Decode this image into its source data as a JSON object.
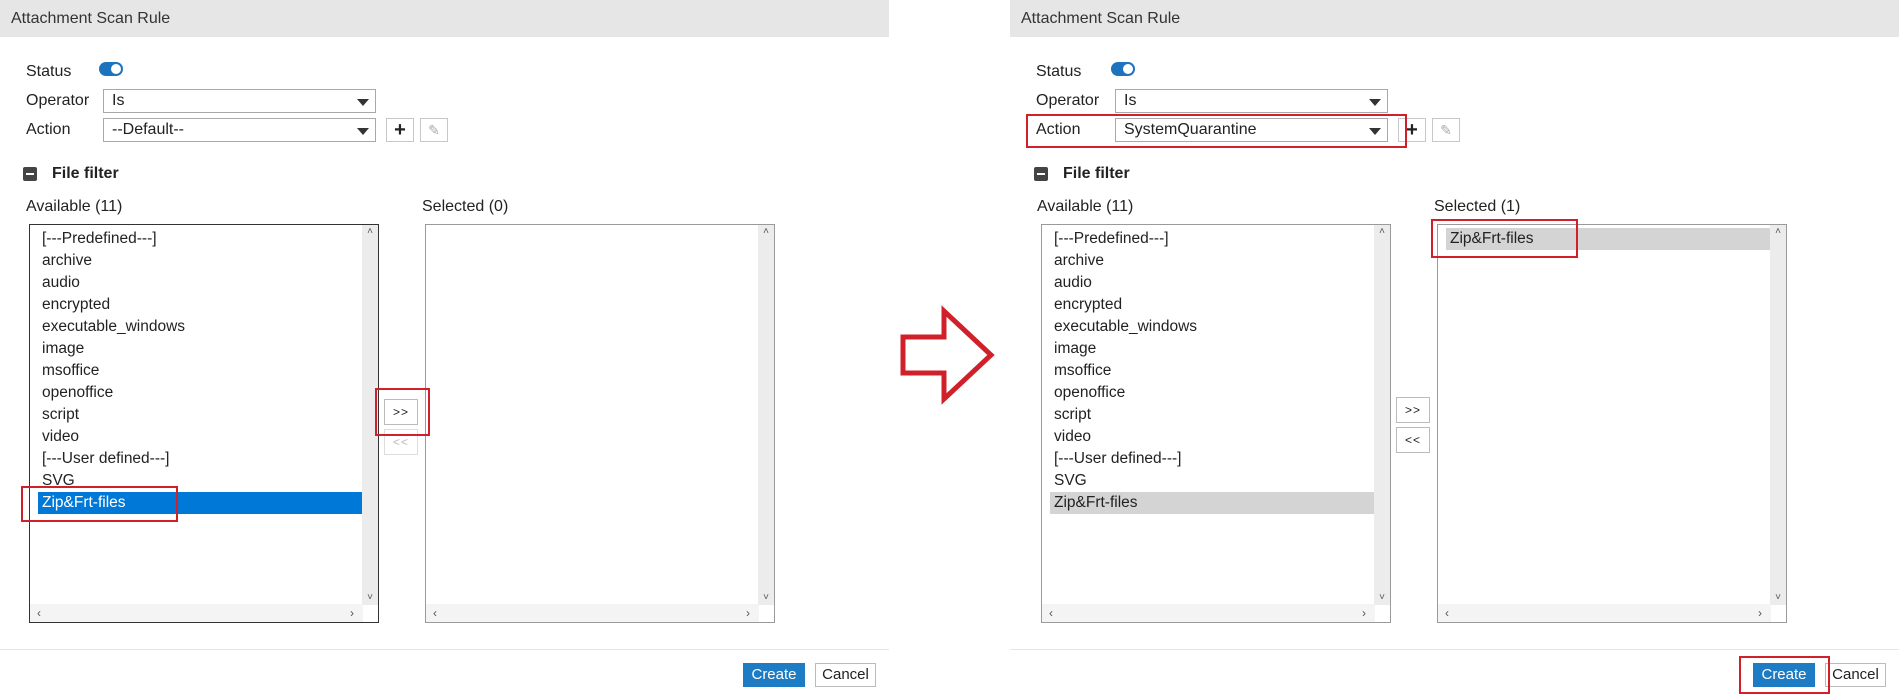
{
  "colors": {
    "accent": "#1e7cc4",
    "selection": "#0078d7",
    "highlight": "#d0202a"
  },
  "before": {
    "title": "Attachment Scan Rule",
    "status_label": "Status",
    "operator_label": "Operator",
    "operator_value": "Is",
    "action_label": "Action",
    "action_value": "--Default--",
    "section_title": "File filter",
    "available_header": "Available (11)",
    "selected_header": "Selected (0)",
    "available_items": [
      "[---Predefined---]",
      "archive",
      "audio",
      "encrypted",
      "executable_windows",
      "image",
      "msoffice",
      "openoffice",
      "script",
      "video",
      "[---User defined---]",
      "SVG",
      "Zip&Frt-files"
    ],
    "selected_items": [],
    "move_right": ">>",
    "move_left": "<<",
    "create": "Create",
    "cancel": "Cancel"
  },
  "after": {
    "title": "Attachment Scan Rule",
    "status_label": "Status",
    "operator_label": "Operator",
    "operator_value": "Is",
    "action_label": "Action",
    "action_value": "SystemQuarantine",
    "section_title": "File filter",
    "available_header": "Available (11)",
    "selected_header": "Selected (1)",
    "available_items": [
      "[---Predefined---]",
      "archive",
      "audio",
      "encrypted",
      "executable_windows",
      "image",
      "msoffice",
      "openoffice",
      "script",
      "video",
      "[---User defined---]",
      "SVG",
      "Zip&Frt-files"
    ],
    "selected_items": [
      "Zip&Frt-files"
    ],
    "move_right": ">>",
    "move_left": "<<",
    "create": "Create",
    "cancel": "Cancel"
  },
  "icons": {
    "add": "plus-icon",
    "edit": "edit-icon",
    "collapse": "minus-icon",
    "transition": "right-arrow-icon"
  }
}
